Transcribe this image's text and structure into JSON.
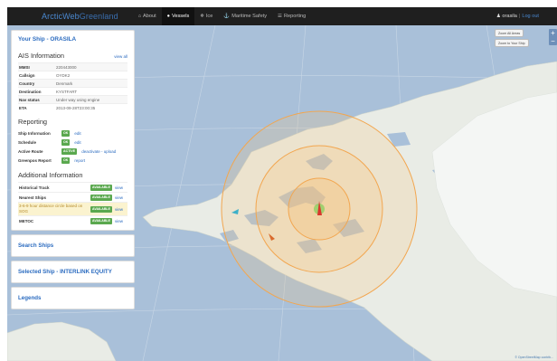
{
  "app": {
    "brand_part1": "ArcticWeb",
    "brand_part2": "Greenland"
  },
  "nav": {
    "items": [
      {
        "label": "About",
        "icon": "home-icon"
      },
      {
        "label": "Vessels",
        "icon": "globe-icon"
      },
      {
        "label": "Ice",
        "icon": "snowflake-icon"
      },
      {
        "label": "Maritime Safety",
        "icon": "ship-icon"
      },
      {
        "label": "Reporting",
        "icon": "list-icon"
      }
    ],
    "active": "Vessels",
    "user": "orasila",
    "logout": "Log out"
  },
  "map": {
    "zoom_all_button": "Zoom All Areas",
    "zoom_ship_button": "Zoom to Your Ship",
    "zoom_in": "+",
    "zoom_out": "−",
    "attribution": "© OpenStreetMap contrib...",
    "colors": {
      "sea": "#a9c0d9",
      "land": "#e9ece6",
      "range_ring": "#f2a64f",
      "ship": "#d9372c"
    }
  },
  "sidebar": {
    "your_ship_title": "Your Ship - ORASILA",
    "ais": {
      "title": "AIS Information",
      "view_all": "view all",
      "rows": [
        {
          "key": "MMSI",
          "value": "220443000"
        },
        {
          "key": "Callsign",
          "value": "OYDK2"
        },
        {
          "key": "Country",
          "value": "Denmark"
        },
        {
          "key": "Destination",
          "value": "KYSTFART"
        },
        {
          "key": "Nav status",
          "value": "Under way using engine"
        },
        {
          "key": "ETA",
          "value": "2013-09-28T23:00:35"
        }
      ]
    },
    "reporting": {
      "title": "Reporting",
      "rows": [
        {
          "key": "Ship Information",
          "badge": "OK",
          "link": "edit"
        },
        {
          "key": "Schedule",
          "badge": "OK",
          "link": "edit"
        },
        {
          "key": "Active Route",
          "badge": "ACTIVE",
          "link": "deactivate - upload"
        },
        {
          "key": "Greenpos Report",
          "badge": "OK",
          "link": "report"
        }
      ]
    },
    "additional": {
      "title": "Additional Information",
      "rows": [
        {
          "key": "Historical Track",
          "badge": "AVAILABLE",
          "link": "view"
        },
        {
          "key": "Nearest Ships",
          "badge": "AVAILABLE",
          "link": "view"
        },
        {
          "key": "3-6-9 hour distance circle based on SOG",
          "badge": "AVAILABLE",
          "link": "view"
        },
        {
          "key": "METOC",
          "badge": "AVAILABLE",
          "link": "view"
        }
      ]
    },
    "search_ships": "Search Ships",
    "selected_ship": "Selected Ship - INTERLINK EQUITY",
    "legends": "Legends"
  }
}
